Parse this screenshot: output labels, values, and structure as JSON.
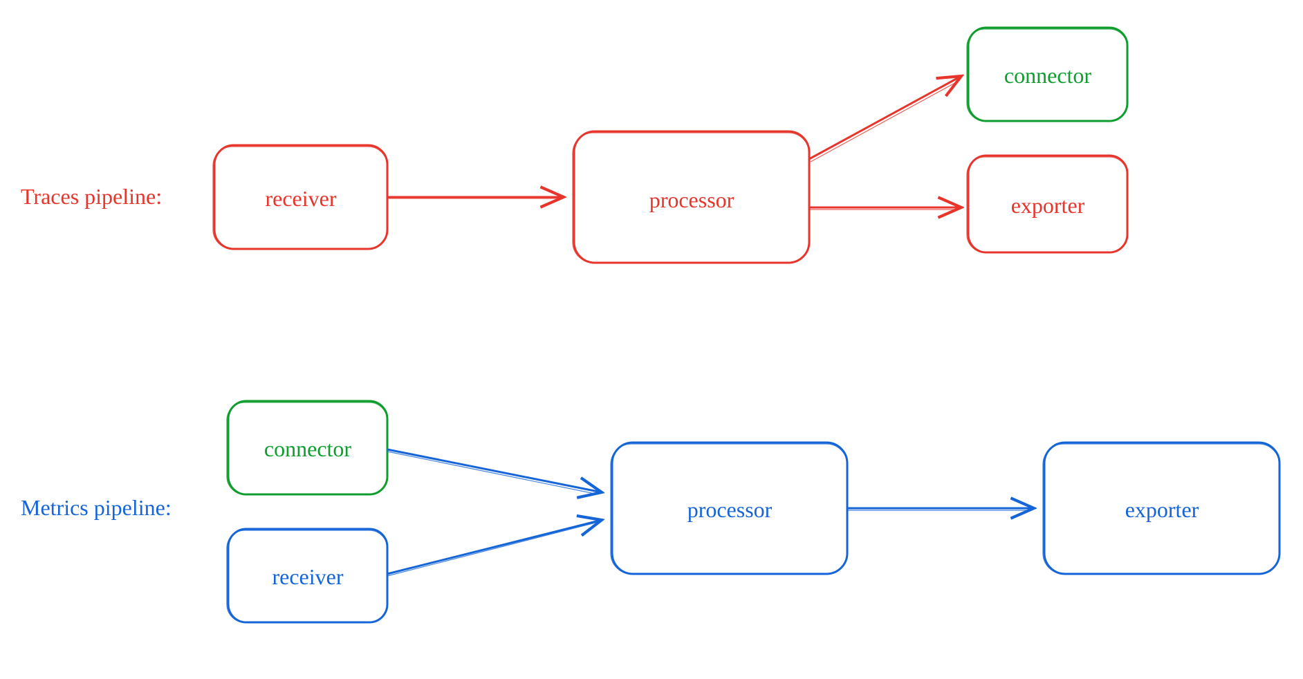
{
  "colors": {
    "red": "#e8352c",
    "green": "#0f9d2e",
    "blue": "#1565d8"
  },
  "traces": {
    "title": "Traces pipeline:",
    "receiver": "receiver",
    "processor": "processor",
    "connector": "connector",
    "exporter": "exporter"
  },
  "metrics": {
    "title": "Metrics pipeline:",
    "connector": "connector",
    "receiver": "receiver",
    "processor": "processor",
    "exporter": "exporter"
  }
}
